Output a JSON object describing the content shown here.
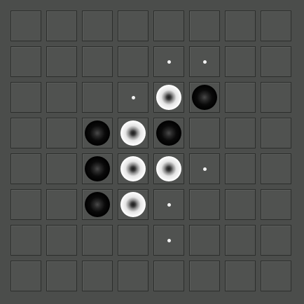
{
  "board": {
    "size": 8,
    "cell_color": "#505250",
    "grid_line_color": "#2c2e2c",
    "background_color": "#4b4d4b",
    "rows": [
      [
        "",
        "",
        "",
        "",
        "",
        "",
        "",
        ""
      ],
      [
        "",
        "",
        "",
        "",
        "hint",
        "hint",
        "",
        ""
      ],
      [
        "",
        "",
        "",
        "hint",
        "white",
        "black",
        "",
        ""
      ],
      [
        "",
        "",
        "black",
        "white",
        "black",
        "",
        "",
        ""
      ],
      [
        "",
        "",
        "black",
        "white",
        "white",
        "hint",
        "",
        ""
      ],
      [
        "",
        "",
        "black",
        "white",
        "hint",
        "",
        "",
        ""
      ],
      [
        "",
        "",
        "",
        "",
        "hint",
        "",
        "",
        ""
      ],
      [
        "",
        "",
        "",
        "",
        "",
        "",
        "",
        ""
      ]
    ]
  },
  "pieces": {
    "black": {
      "icon": "black-disc-icon",
      "color": "#000000"
    },
    "white": {
      "icon": "white-disc-icon",
      "color": "#ffffff"
    },
    "hint": {
      "icon": "legal-move-dot-icon",
      "color": "#f2f2f2"
    }
  }
}
